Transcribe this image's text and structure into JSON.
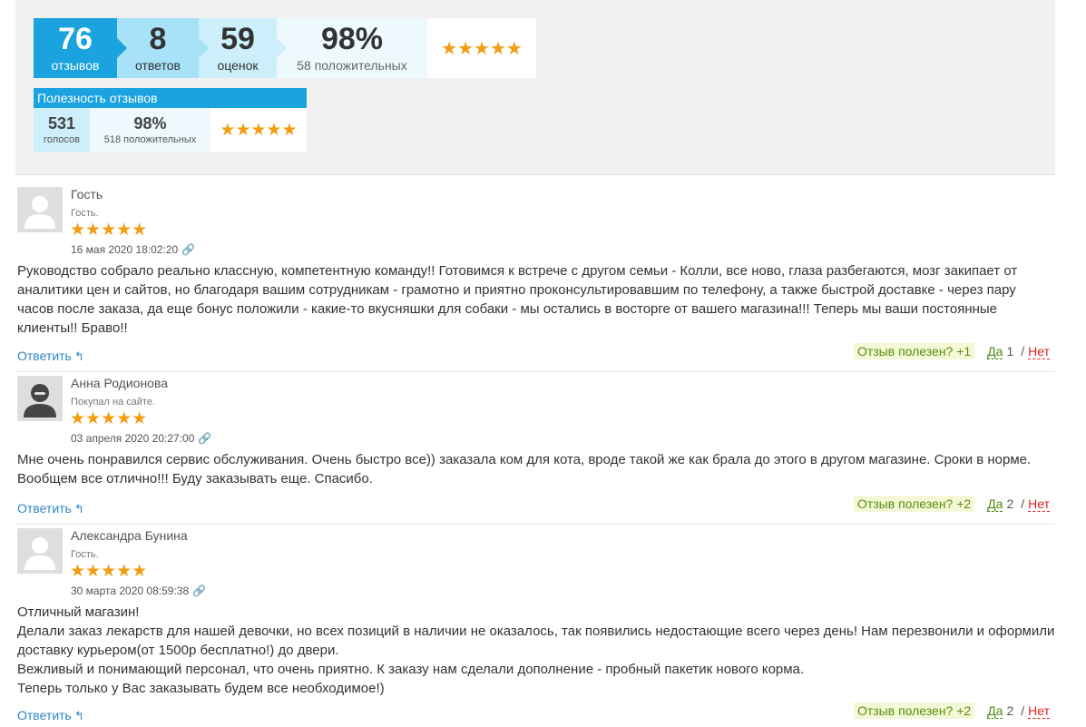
{
  "summary": {
    "reviews": {
      "num": "76",
      "label": "отзывов"
    },
    "answers": {
      "num": "8",
      "label": "ответов"
    },
    "ratings": {
      "num": "59",
      "label": "оценок"
    },
    "positive": {
      "num": "98%",
      "label": "58 положительных"
    },
    "stars": "★★★★★"
  },
  "usefulness": {
    "title": "Полезность отзывов",
    "votes": {
      "num": "531",
      "label": "голосов"
    },
    "positive": {
      "num": "98%",
      "label": "518 положительных"
    },
    "stars": "★★★★★"
  },
  "reviews": [
    {
      "author": "Гость",
      "status": "Гость.",
      "stars": "★★★★★",
      "date": "16 мая 2020 18:02:20",
      "text": "Руководство собрало реально классную, компетентную команду!! Готовимся к встрече с другом семьи - Колли, все ново, глаза разбегаются, мозг закипает от аналитики цен и сайтов, но благодаря вашим сотрудникам - грамотно и приятно проконсультировавшим по телефону, а также быстрой доставке - через пару часов после заказа, да еще бонус положили - какие-то вкусняшки для собаки - мы остались в восторге от вашего магазина!!! Теперь мы ваши постоянные клиенты!! Браво!!",
      "reply": "Ответить",
      "useful": "Отзыв полезен? +1",
      "yes": "Да",
      "count": "1",
      "slash": "/",
      "no": "Нет"
    },
    {
      "author": "Анна Родионова",
      "status": "Покупал на сайте.",
      "stars": "★★★★★",
      "date": "03 апреля 2020 20:27:00",
      "text": "Мне очень понравился сервис обслуживания. Очень быстро все)) заказала ком для кота, вроде такой же как брала до этого в другом магазине. Сроки в норме. Вообщем все отлично!!! Буду заказывать еще. Спасибо.",
      "reply": "Ответить",
      "useful": "Отзыв полезен? +2",
      "yes": "Да",
      "count": "2",
      "slash": "/",
      "no": "Нет"
    },
    {
      "author": "Александра Бунина",
      "status": "Гость.",
      "stars": "★★★★★",
      "date": "30 марта 2020 08:59:38",
      "text": " Отличный магазин!\nДелали заказ лекарств для нашей девочки, но всех позиций в наличии не оказалось, так появились недостающие всего через день! Нам перезвонили и оформили доставку курьером(от 1500р бесплатно!) до двери.\nВежливый и понимающий персонал, что очень приятно. К заказу нам сделали дополнение - пробный пакетик нового корма.\nТеперь только у Вас заказывать будем все необходимое!)",
      "reply": "Ответить",
      "useful": "Отзыв полезен? +2",
      "yes": "Да",
      "count": "2",
      "slash": "/",
      "no": "Нет"
    }
  ]
}
